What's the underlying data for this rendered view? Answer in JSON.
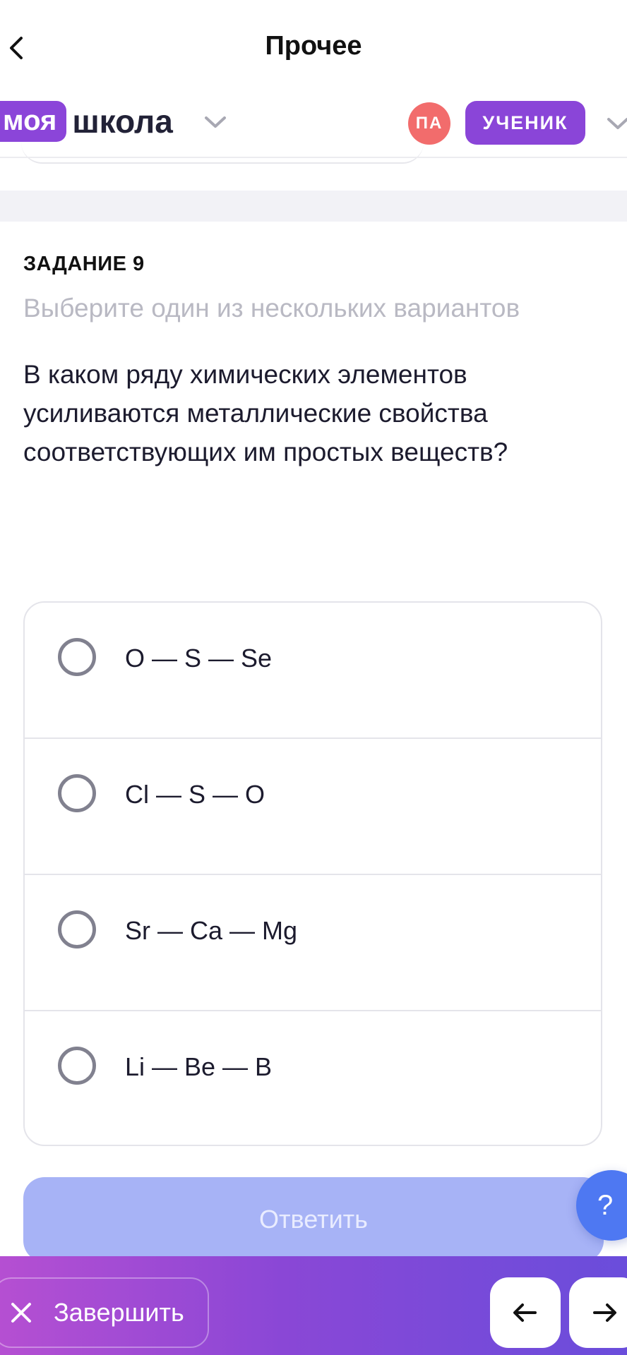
{
  "header": {
    "title": "Прочее"
  },
  "school": {
    "logo_part1": "моя",
    "logo_part2": "школа",
    "avatar_initials": "ПА",
    "role": "УЧЕНИК"
  },
  "task": {
    "label": "ЗАДАНИЕ 9",
    "hint": "Выберите один из нескольких вариантов",
    "question": "В каком ряду химических элементов усиливаются металлические свойства соответствующих им простых веществ?",
    "options": [
      {
        "text": "O — S — Se"
      },
      {
        "text": "Cl — S — O"
      },
      {
        "text": "Sr — Ca — Mg"
      },
      {
        "text": "Li — Be — B"
      }
    ],
    "answer_label": "Ответить",
    "help_label": "?"
  },
  "footer": {
    "finish_label": "Завершить"
  },
  "colors": {
    "brand_purple": "#8a45d8",
    "avatar_red": "#f26c6c",
    "answer_disabled": "#a7b3f6",
    "help_blue": "#4e78f2"
  }
}
